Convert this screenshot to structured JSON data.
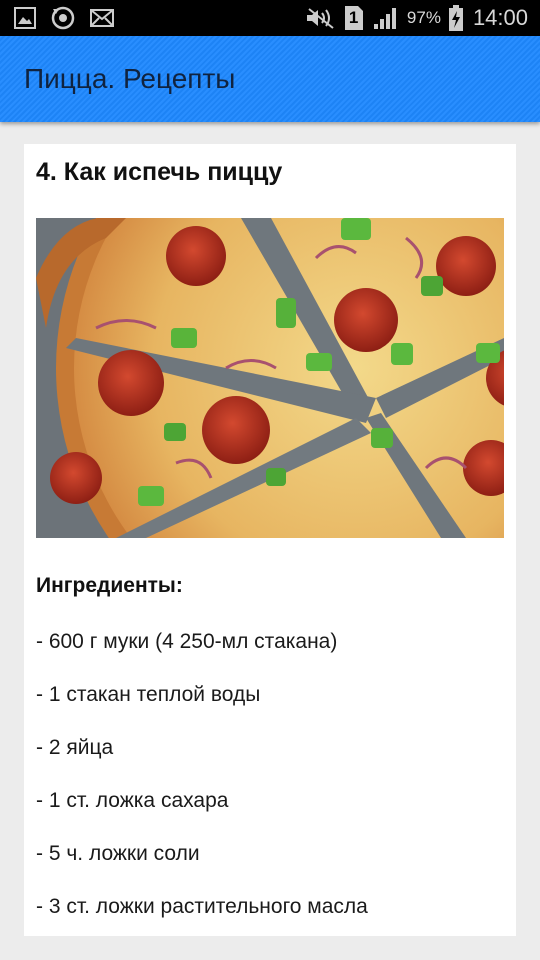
{
  "status_bar": {
    "battery_percent": "97%",
    "time": "14:00",
    "sim_slot": "1",
    "icons": [
      "gallery-icon",
      "sync-icon",
      "mail-icon",
      "mute-icon",
      "sim-icon",
      "signal-icon",
      "battery-icon"
    ]
  },
  "app_bar": {
    "title": "Пицца. Рецепты",
    "color": "#1e88ff"
  },
  "recipe": {
    "title": "4. Как испечь пиццу",
    "image_subject": "pizza",
    "ingredients_heading": "Ингредиенты:",
    "ingredients": [
      "- 600 г муки (4 250-мл стакана)",
      "- 1 стакан теплой воды",
      "- 2 яйца",
      "- 1 ст. ложка сахара",
      "- 5 ч. ложки соли",
      "- 3 ст. ложки растительного масла"
    ]
  }
}
